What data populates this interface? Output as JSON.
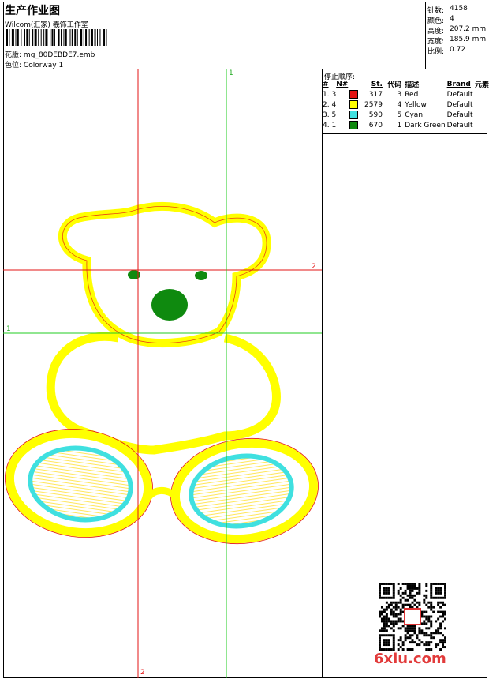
{
  "header": {
    "title": "生产作业图",
    "company": "Wilcom(汇家) 羲饰工作室",
    "design_label": "花版:",
    "design_value": "mg_80DEBDE7.emb",
    "colorway_label": "色位:",
    "colorway_value": "Colorway 1"
  },
  "stats": [
    {
      "label": "针数:",
      "value": "4158"
    },
    {
      "label": "颜色:",
      "value": "4"
    },
    {
      "label": "高度:",
      "value": "207.2 mm"
    },
    {
      "label": "宽度:",
      "value": "185.9 mm"
    },
    {
      "label": "比例:",
      "value": "0.72"
    }
  ],
  "stop_sequence": {
    "title": "停止顺序:",
    "headers": [
      "#",
      "N#",
      "St.",
      "代码",
      "描述",
      "Brand",
      "元素"
    ],
    "rows": [
      {
        "idx": "1. 3",
        "color": "#e31414",
        "st": "317",
        "code": "3",
        "desc": "Red",
        "brand": "Default"
      },
      {
        "idx": "2. 4",
        "color": "#ffff00",
        "st": "2579",
        "code": "4",
        "desc": "Yellow",
        "brand": "Default"
      },
      {
        "idx": "3. 5",
        "color": "#3fe0e0",
        "st": "590",
        "code": "5",
        "desc": "Cyan",
        "brand": "Default"
      },
      {
        "idx": "4. 1",
        "color": "#0f8a0f",
        "st": "670",
        "code": "1",
        "desc": "Dark Green",
        "brand": "Default"
      }
    ]
  },
  "axes": {
    "green_top": "1",
    "green_left": "1",
    "red_right": "2",
    "red_bottom": "2"
  },
  "watermark": "6xiu.com"
}
